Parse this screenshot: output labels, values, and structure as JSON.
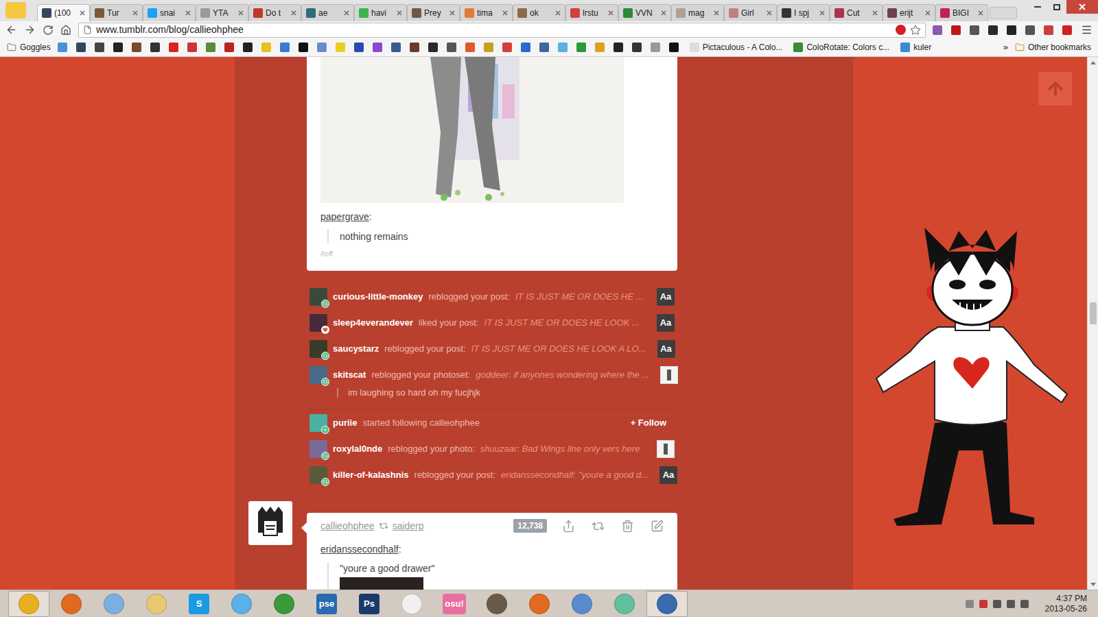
{
  "browser": {
    "tabs": [
      {
        "label": "(100",
        "selected": true
      },
      {
        "label": "Tur",
        "selected": false
      },
      {
        "label": "snai",
        "selected": false
      },
      {
        "label": "YTA",
        "selected": false
      },
      {
        "label": "Do t",
        "selected": false
      },
      {
        "label": "ae",
        "selected": false
      },
      {
        "label": "havi",
        "selected": false
      },
      {
        "label": "Prey",
        "selected": false
      },
      {
        "label": "tima",
        "selected": false
      },
      {
        "label": "ok",
        "selected": false
      },
      {
        "label": "lrstu",
        "selected": false
      },
      {
        "label": "VVN",
        "selected": false
      },
      {
        "label": "mag",
        "selected": false
      },
      {
        "label": "Girl",
        "selected": false
      },
      {
        "label": "I spj",
        "selected": false
      },
      {
        "label": "Cut",
        "selected": false
      },
      {
        "label": "erijt",
        "selected": false
      },
      {
        "label": "BIGI",
        "selected": false
      }
    ],
    "address": "www.tumblr.com/blog/callieohphee",
    "bookmarks": {
      "first": "Goggles",
      "named": [
        "Pictaculous - A Colo...",
        "ColoRotate: Colors c...",
        "kuler"
      ],
      "more": "»",
      "other": "Other bookmarks"
    }
  },
  "post_top": {
    "source": "papergrave",
    "suffix": ":",
    "quote": "nothing remains",
    "tag": "#off"
  },
  "notifications": [
    {
      "type": "reblog",
      "kind": "text",
      "name": "curious-little-monkey",
      "action": "reblogged your post:",
      "excerpt": "IT IS JUST ME OR DOES HE ...",
      "badge": "Aa"
    },
    {
      "type": "like",
      "kind": "text",
      "name": "sleep4everandever",
      "action": "liked your post:",
      "excerpt": "IT IS JUST ME OR DOES HE LOOK ...",
      "badge": "Aa"
    },
    {
      "type": "reblog",
      "kind": "text",
      "name": "saucystarz",
      "action": "reblogged your post:",
      "excerpt": "IT IS JUST ME OR DOES HE LOOK A LO...",
      "badge": "Aa"
    },
    {
      "type": "reblog",
      "kind": "photo",
      "name": "skitscat",
      "action": "reblogged your photoset:",
      "excerpt": "goddeer: if anyones wondering where the ...",
      "reply": "im laughing so hard oh my fucjhjk"
    },
    {
      "type": "follow",
      "kind": "follow",
      "name": "puriie",
      "action": "started following callieohphee",
      "button": "+ Follow"
    },
    {
      "type": "reblog",
      "kind": "photo",
      "name": "roxylal0nde",
      "action": "reblogged your photo:",
      "excerpt": "shuuzaar: Bad Wings line only vers here"
    },
    {
      "type": "reblog",
      "kind": "text",
      "name": "killer-of-kalashnis",
      "action": "reblogged your post:",
      "excerpt": "eridanssecondhalf: \"youre a good d...",
      "badge": "Aa"
    }
  ],
  "post": {
    "blog": "callieohphee",
    "reblogged_from": "saiderp",
    "notes": "12,738",
    "source": "eridanssecondhalf",
    "suffix": ":",
    "quote": "\"youre a good drawer\""
  },
  "scrollbar": {
    "position": 0.48
  },
  "taskbar": {
    "apps": [
      {
        "kind": "icon",
        "active": true
      },
      {
        "kind": "icon",
        "active": false
      },
      {
        "kind": "icon",
        "active": false
      },
      {
        "kind": "icon",
        "active": false
      },
      {
        "kind": "label",
        "glyph": "S",
        "active": false
      },
      {
        "kind": "icon",
        "active": false
      },
      {
        "kind": "icon",
        "active": false
      },
      {
        "kind": "label",
        "glyph": "pse",
        "active": false
      },
      {
        "kind": "label",
        "glyph": "Ps",
        "active": false
      },
      {
        "kind": "icon",
        "active": false
      },
      {
        "kind": "label",
        "glyph": "osu!",
        "active": false
      },
      {
        "kind": "icon",
        "active": false
      },
      {
        "kind": "icon",
        "active": false
      },
      {
        "kind": "icon",
        "active": false
      },
      {
        "kind": "icon",
        "active": false
      },
      {
        "kind": "icon",
        "active": true
      }
    ],
    "time": "4:37 PM",
    "date": "2013-05-26"
  }
}
